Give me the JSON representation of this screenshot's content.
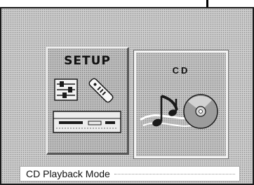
{
  "menu": {
    "tiles": [
      {
        "label": "SETUP",
        "icon": "setup-icon",
        "selected": false
      },
      {
        "label": "CD",
        "icon": "cd-music-icon",
        "selected": true
      }
    ]
  },
  "status": {
    "text": "CD Playback Mode"
  },
  "colors": {
    "screen_background": "#c2c2c2",
    "tile_highlight": "#f4f4f4",
    "pointer_line": "#000000",
    "status_background": "#ffffff"
  }
}
